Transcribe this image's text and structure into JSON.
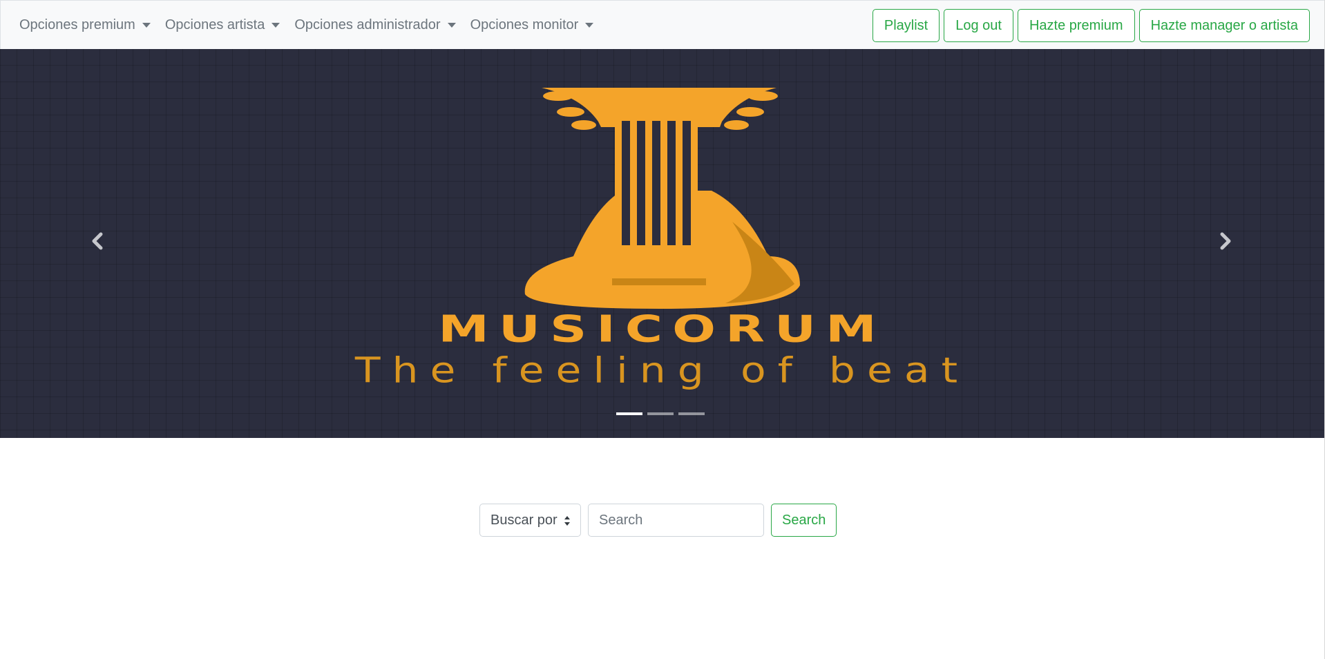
{
  "navbar": {
    "dropdowns": [
      {
        "label": "Opciones premium"
      },
      {
        "label": "Opciones artista"
      },
      {
        "label": "Opciones administrador"
      },
      {
        "label": "Opciones monitor"
      }
    ],
    "buttons": [
      {
        "label": "Playlist"
      },
      {
        "label": "Log out"
      },
      {
        "label": "Hazte premium"
      },
      {
        "label": "Hazte manager o artista"
      }
    ],
    "accent_color": "#28a745",
    "background_color": "#f8f9fa"
  },
  "carousel": {
    "slide_title": "MUSICORUM",
    "slide_tagline": "The feeling of beat",
    "logo_icon": "lyre-logo-icon",
    "prev_icon": "chevron-left-icon",
    "next_icon": "chevron-right-icon",
    "indicator_count": 3,
    "active_indicator": 1,
    "logo_color": "#f4a42a",
    "background_color": "#2b2d3e"
  },
  "search": {
    "select_value": "Buscar por",
    "input_placeholder": "Search",
    "input_value": "",
    "button_label": "Search"
  }
}
